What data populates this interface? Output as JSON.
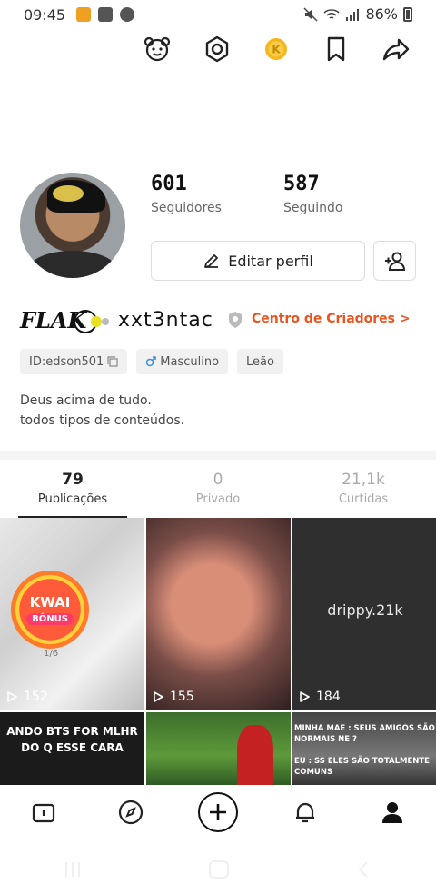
{
  "status_bar": {
    "time": "09:45",
    "battery_percent": "86%"
  },
  "profile": {
    "followers": {
      "count": "601",
      "label": "Seguidores"
    },
    "following": {
      "count": "587",
      "label": "Seguindo"
    },
    "edit_button_label": "Editar perfil",
    "display_name": "FLAK",
    "handle_text": "xxt3ntac",
    "creator_center_label": "Centro de Criadores >",
    "tags": [
      {
        "label": "ID:edson501"
      },
      {
        "label": "Masculino"
      },
      {
        "label": "Leão"
      }
    ],
    "bio_lines": [
      "Deus acima de tudo.",
      "todos tipos de conteúdos."
    ]
  },
  "tabs": [
    {
      "count": "79",
      "label": "Publicações"
    },
    {
      "count": "0",
      "label": "Privado"
    },
    {
      "count": "21,1k",
      "label": "Curtidas"
    }
  ],
  "grid": {
    "items": [
      {
        "views": "152",
        "badge_title": "KWAI",
        "badge_sub": "BÔNUS",
        "badge_count": "1/6"
      },
      {
        "views": "155"
      },
      {
        "views": "184",
        "overlay_text": "drippy.21k"
      },
      {
        "overlay_text": "ANDO BTS FOR MLHR DO Q ESSE CARA"
      },
      {},
      {
        "overlay_text": "MINHA MAE : SEUS AMIGOS SÃO NORMAIS NE ?",
        "overlay_text_2": "EU : SS ELES SÃO TOTALMENTE COMUNS"
      }
    ]
  },
  "colors": {
    "accent": "#e8551f",
    "coin": "#f5b81c",
    "male_icon": "#3a8ee0"
  }
}
